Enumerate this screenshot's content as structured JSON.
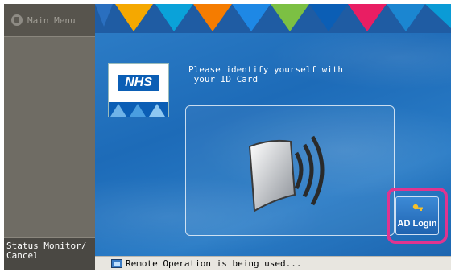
{
  "sidebar": {
    "main_menu_label": "Main Menu",
    "status_monitor_label": "Status Monitor/\nCancel"
  },
  "header": {
    "triangle_colors": [
      "#f5a800",
      "#0aa2d9",
      "#f57c00",
      "#1e88e5",
      "#7cc043",
      "#0b5eb5",
      "#e91e63",
      "#1b86d1"
    ]
  },
  "card": {
    "brand": "NHS"
  },
  "prompt": {
    "text": "Please identify yourself with\n your ID Card"
  },
  "ad_login": {
    "label": "AD Login",
    "highlight_color": "#e0348f"
  },
  "statusbar": {
    "text": "Remote Operation is being used..."
  }
}
